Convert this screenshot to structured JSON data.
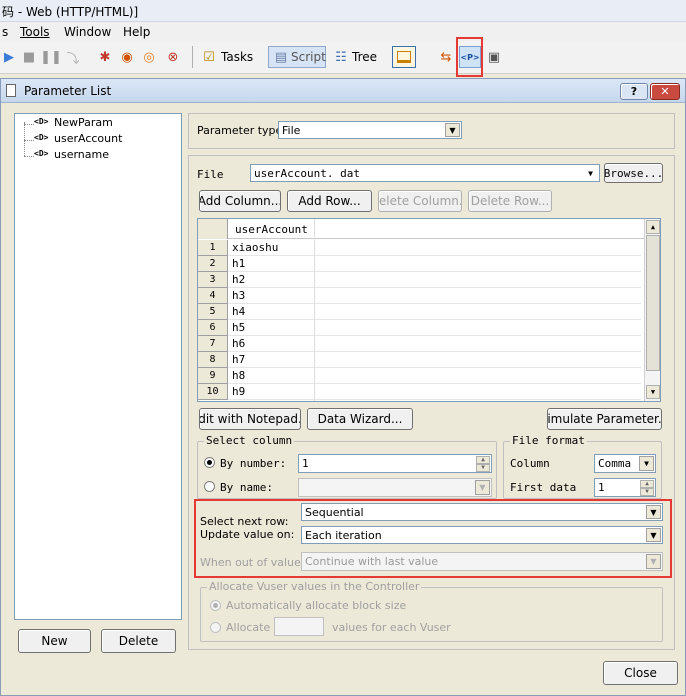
{
  "app": {
    "title": "码 - Web (HTTP/HTML)]",
    "menu": [
      "s",
      "Tools",
      "Window",
      "Help"
    ],
    "toolbar": {
      "tasks_label": "Tasks",
      "script_label": "Script",
      "tree_label": "Tree"
    }
  },
  "dialog": {
    "title": "Parameter List",
    "help_glyph": "?",
    "close_glyph": "✕",
    "params": [
      "NewParam",
      "userAccount",
      "username"
    ],
    "param_glyph": "<D>",
    "new_label": "New",
    "delete_label": "Delete",
    "close_label": "Close",
    "param_type_label": "Parameter type:",
    "param_type_value": "File",
    "file_label": "File",
    "file_value": "userAccount. dat",
    "browse_label": "Browse...",
    "add_column_label": "Add Column...",
    "add_row_label": "Add Row...",
    "delete_column_label": "Delete Column...",
    "delete_row_label": "Delete Row...",
    "grid": {
      "header": "userAccount",
      "row_numbers": [
        "1",
        "2",
        "3",
        "4",
        "5",
        "6",
        "7",
        "8",
        "9",
        "10"
      ],
      "rows": [
        "xiaoshu",
        "h1",
        "h2",
        "h3",
        "h4",
        "h5",
        "h6",
        "h7",
        "h8",
        "h9"
      ]
    },
    "edit_notepad_label": "Edit with Notepad...",
    "data_wizard_label": "Data Wizard...",
    "simulate_label": "Simulate Parameter...",
    "select_column_title": "Select column",
    "by_number_label": "By number:",
    "by_number_value": "1",
    "by_name_label": "By name:",
    "file_format_title": "File format",
    "column_label": "Column",
    "column_value": "Comma",
    "first_data_label": "First data",
    "first_data_value": "1",
    "select_next_row_label": "Select next row:",
    "select_next_row_value": "Sequential",
    "update_value_label": "Update value on:",
    "update_value_value": "Each iteration",
    "out_of_values_label": "When out of values:",
    "out_of_values_value": "Continue with last value",
    "allocate_group_title": "Allocate Vuser values in the Controller",
    "auto_allocate_label": "Automatically allocate block size",
    "allocate_label": "Allocate",
    "values_each_vuser_label": "values for each Vuser"
  },
  "colors": {
    "highlight": "#e53935",
    "titlebar": "#c9d9ee"
  }
}
